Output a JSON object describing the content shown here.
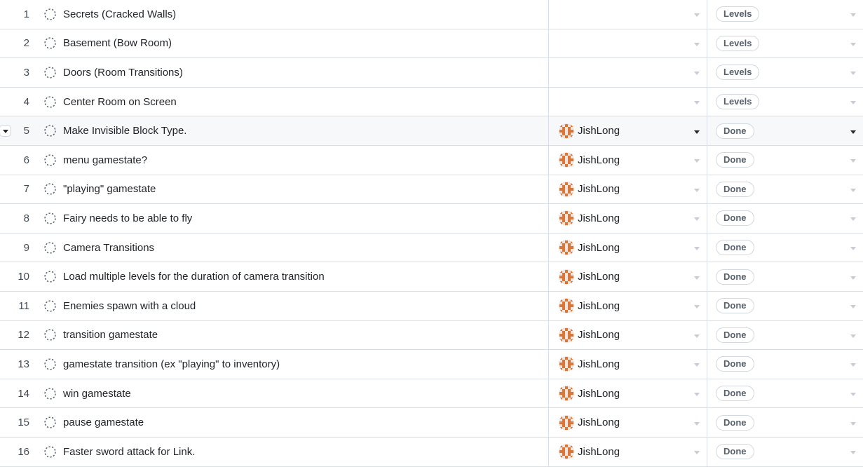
{
  "rows": [
    {
      "num": "1",
      "title": "Secrets (Cracked Walls)",
      "assignee": "",
      "status": "Levels"
    },
    {
      "num": "2",
      "title": "Basement (Bow Room)",
      "assignee": "",
      "status": "Levels"
    },
    {
      "num": "3",
      "title": "Doors (Room Transitions)",
      "assignee": "",
      "status": "Levels"
    },
    {
      "num": "4",
      "title": "Center Room on Screen",
      "assignee": "",
      "status": "Levels"
    },
    {
      "num": "5",
      "title": "Make Invisible Block Type.",
      "assignee": "JishLong",
      "status": "Done"
    },
    {
      "num": "6",
      "title": "menu gamestate?",
      "assignee": "JishLong",
      "status": "Done"
    },
    {
      "num": "7",
      "title": "\"playing\" gamestate",
      "assignee": "JishLong",
      "status": "Done"
    },
    {
      "num": "8",
      "title": "Fairy needs to be able to fly",
      "assignee": "JishLong",
      "status": "Done"
    },
    {
      "num": "9",
      "title": "Camera Transitions",
      "assignee": "JishLong",
      "status": "Done"
    },
    {
      "num": "10",
      "title": "Load multiple levels for the duration of camera transition",
      "assignee": "JishLong",
      "status": "Done"
    },
    {
      "num": "11",
      "title": "Enemies spawn with a cloud",
      "assignee": "JishLong",
      "status": "Done"
    },
    {
      "num": "12",
      "title": "transition gamestate",
      "assignee": "JishLong",
      "status": "Done"
    },
    {
      "num": "13",
      "title": "gamestate transition (ex \"playing\" to inventory)",
      "assignee": "JishLong",
      "status": "Done"
    },
    {
      "num": "14",
      "title": "win gamestate",
      "assignee": "JishLong",
      "status": "Done"
    },
    {
      "num": "15",
      "title": "pause gamestate",
      "assignee": "JishLong",
      "status": "Done"
    },
    {
      "num": "16",
      "title": "Faster sword attack for Link.",
      "assignee": "JishLong",
      "status": "Done"
    }
  ],
  "hovered_row": "5",
  "icons": {
    "status": "draft-issue-circle-icon",
    "avatar": "pixel-identicon-avatar",
    "caret": "caret-down-icon"
  },
  "colors": {
    "avatar": "#d9773a",
    "border": "#d8dee4",
    "hover_bg": "#f6f8fa"
  }
}
